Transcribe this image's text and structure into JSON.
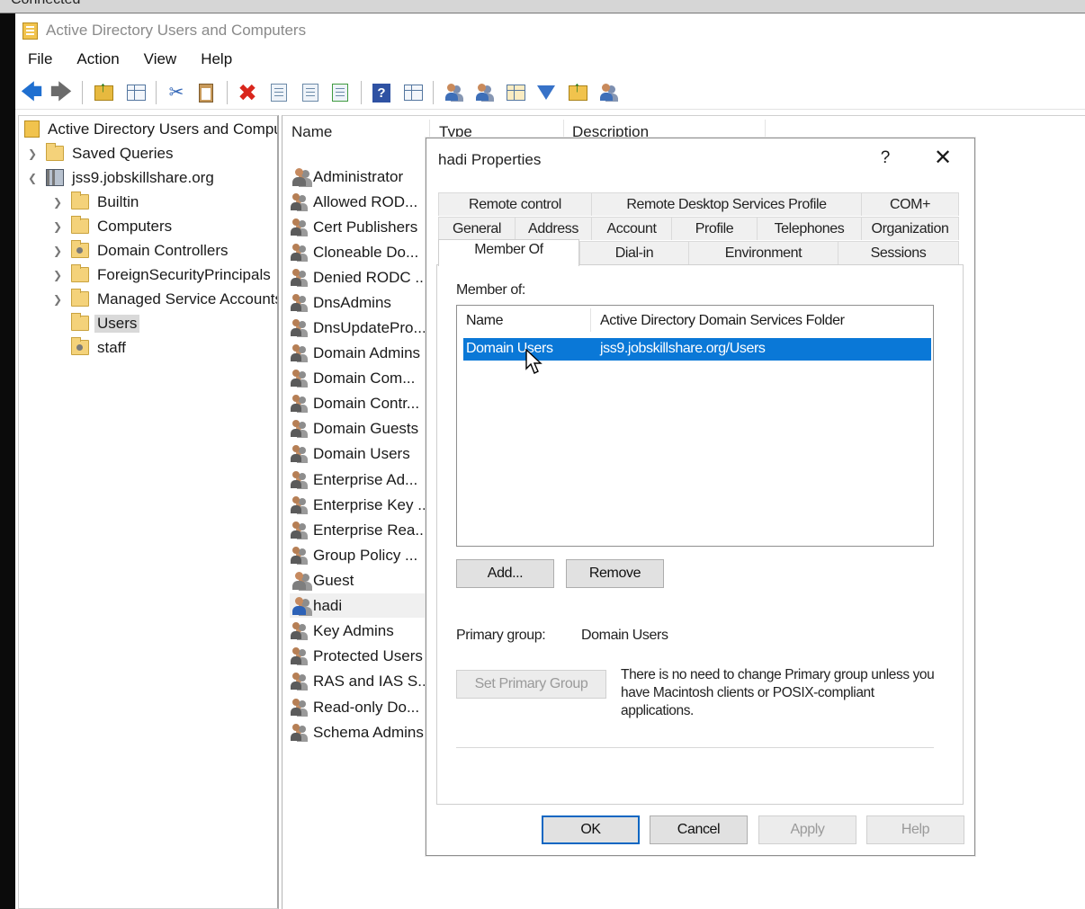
{
  "outer": {
    "status_text": "Connected"
  },
  "window": {
    "title": "Active Directory Users and Computers"
  },
  "menu": [
    "File",
    "Action",
    "View",
    "Help"
  ],
  "toolbar": {
    "icons": [
      "back-arrow-icon",
      "forward-arrow-icon",
      "folder-up-icon",
      "console-tree-icon",
      "cut-icon",
      "clipboard-icon",
      "delete-icon",
      "properties-icon",
      "refresh-icon",
      "export-list-icon",
      "help-icon",
      "view-icon",
      "new-user-icon",
      "new-group-icon",
      "new-ou-icon",
      "filter-icon",
      "find-icon",
      "add-to-group-icon"
    ]
  },
  "tree": {
    "root": "Active Directory Users and Computers",
    "saved_queries": "Saved Queries",
    "domain": "jss9.jobskillshare.org",
    "children": [
      "Builtin",
      "Computers",
      "Domain Controllers",
      "ForeignSecurityPrincipals",
      "Managed Service Accounts",
      "Users",
      "staff"
    ],
    "selected": "Users"
  },
  "list": {
    "columns": [
      "Name",
      "Type",
      "Description"
    ],
    "items": [
      "Administrator",
      "Allowed ROD...",
      "Cert Publishers",
      "Cloneable Do...",
      "Denied RODC ...",
      "DnsAdmins",
      "DnsUpdatePro...",
      "Domain Admins",
      "Domain Com...",
      "Domain Contr...",
      "Domain Guests",
      "Domain Users",
      "Enterprise Ad...",
      "Enterprise Key ...",
      "Enterprise Rea...",
      "Group Policy ...",
      "Guest",
      "hadi",
      "Key Admins",
      "Protected Users",
      "RAS and IAS S...",
      "Read-only Do...",
      "Schema Admins"
    ]
  },
  "dialog": {
    "title": "hadi Properties",
    "help_glyph": "?",
    "close_glyph": "✕",
    "tabs_row1": [
      "Remote control",
      "Remote Desktop Services Profile",
      "COM+"
    ],
    "tabs_row2": [
      "General",
      "Address",
      "Account",
      "Profile",
      "Telephones",
      "Organization"
    ],
    "tabs_row3": [
      "Member Of",
      "Dial-in",
      "Environment",
      "Sessions"
    ],
    "active_tab": "Member Of",
    "member_of_label": "Member of:",
    "member_columns": [
      "Name",
      "Active Directory Domain Services Folder"
    ],
    "members": [
      {
        "name": "Domain Users",
        "folder": "jss9.jobskillshare.org/Users"
      }
    ],
    "add_button": "Add...",
    "remove_button": "Remove",
    "primary_group_label": "Primary group:",
    "primary_group_value": "Domain Users",
    "set_primary_button": "Set Primary Group",
    "primary_note": "There is no need to change Primary group unless you have Macintosh clients or POSIX-compliant applications.",
    "ok": "OK",
    "cancel": "Cancel",
    "apply": "Apply",
    "help": "Help"
  },
  "colors": {
    "selection": "#0a78d7",
    "default_button_border": "#0a66c2",
    "folder": "#f4d27a",
    "delete": "#d9261c"
  }
}
